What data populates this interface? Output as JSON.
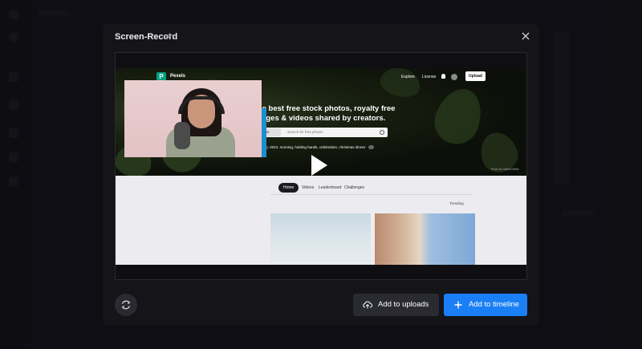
{
  "modal": {
    "title": "Screen-Record",
    "edit_icon": "pencil-icon",
    "close_icon": "close-icon"
  },
  "preview": {
    "site": {
      "logo_letter": "P",
      "brand": "Pexels",
      "nav": [
        "Explore",
        "License"
      ],
      "upload_label": "Upload",
      "headline": "The best free stock photos, royalty free images & videos shared by creators.",
      "search_type": "Photos",
      "search_placeholder": "Search for free photos",
      "trending_label": "Trending:",
      "trending_items": "2024, morning, holding hands, celebration, christmas dinner",
      "photo_credit": "Photo by Valeria Miller",
      "tabs": [
        "Home",
        "Videos",
        "Leaderboard",
        "Challenges"
      ],
      "sort_label": "Trending"
    },
    "play_icon": "play-icon"
  },
  "actions": {
    "replace_icon": "refresh-icon",
    "uploads_label": "Add to uploads",
    "uploads_icon": "cloud-upload-icon",
    "timeline_label": "Add to timeline",
    "timeline_icon": "plus-icon"
  },
  "colors": {
    "primary": "#1a7ff5",
    "modal_bg": "#141419",
    "secondary_btn": "#2a2a31",
    "pexels_green": "#05a081"
  }
}
